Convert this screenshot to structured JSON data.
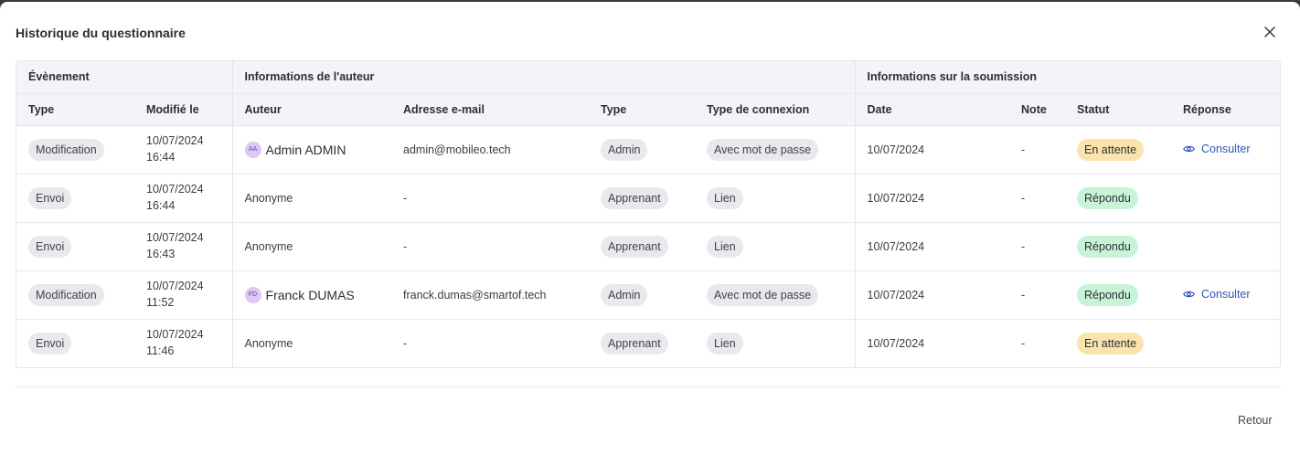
{
  "modal": {
    "title": "Historique du questionnaire",
    "close_icon": "close-icon",
    "footer_button": "Retour"
  },
  "table": {
    "groups": [
      "Évènement",
      "Informations de l'auteur",
      "Informations sur la soumission"
    ],
    "columns": [
      "Type",
      "Modifié le",
      "Auteur",
      "Adresse e-mail",
      "Type",
      "Type de connexion",
      "Date",
      "Note",
      "Statut",
      "Réponse"
    ],
    "rows": [
      {
        "event_type": "Modification",
        "modified_date": "10/07/2024",
        "modified_time": "16:44",
        "author_initials": "AA",
        "author": "Admin ADMIN",
        "email": "admin@mobileo.tech",
        "user_type": "Admin",
        "connection": "Avec mot de passe",
        "date": "10/07/2024",
        "note": "-",
        "status": "En attente",
        "response": "Consulter"
      },
      {
        "event_type": "Envoi",
        "modified_date": "10/07/2024",
        "modified_time": "16:44",
        "author": "Anonyme",
        "email": "-",
        "user_type": "Apprenant",
        "connection": "Lien",
        "date": "10/07/2024",
        "note": "-",
        "status": "Répondu"
      },
      {
        "event_type": "Envoi",
        "modified_date": "10/07/2024",
        "modified_time": "16:43",
        "author": "Anonyme",
        "email": "-",
        "user_type": "Apprenant",
        "connection": "Lien",
        "date": "10/07/2024",
        "note": "-",
        "status": "Répondu"
      },
      {
        "event_type": "Modification",
        "modified_date": "10/07/2024",
        "modified_time": "11:52",
        "author_initials": "FD",
        "author": "Franck DUMAS",
        "email": "franck.dumas@smartof.tech",
        "user_type": "Admin",
        "connection": "Avec mot de passe",
        "date": "10/07/2024",
        "note": "-",
        "status": "Répondu",
        "response": "Consulter"
      },
      {
        "event_type": "Envoi",
        "modified_date": "10/07/2024",
        "modified_time": "11:46",
        "author": "Anonyme",
        "email": "-",
        "user_type": "Apprenant",
        "connection": "Lien",
        "date": "10/07/2024",
        "note": "-",
        "status": "En attente"
      }
    ]
  },
  "icons": {
    "view": "eye-icon"
  },
  "colors": {
    "pending": "#fbe3ad",
    "done": "#c7f3d6",
    "link": "#2f55b8",
    "avatar": "#dcc7f5"
  }
}
